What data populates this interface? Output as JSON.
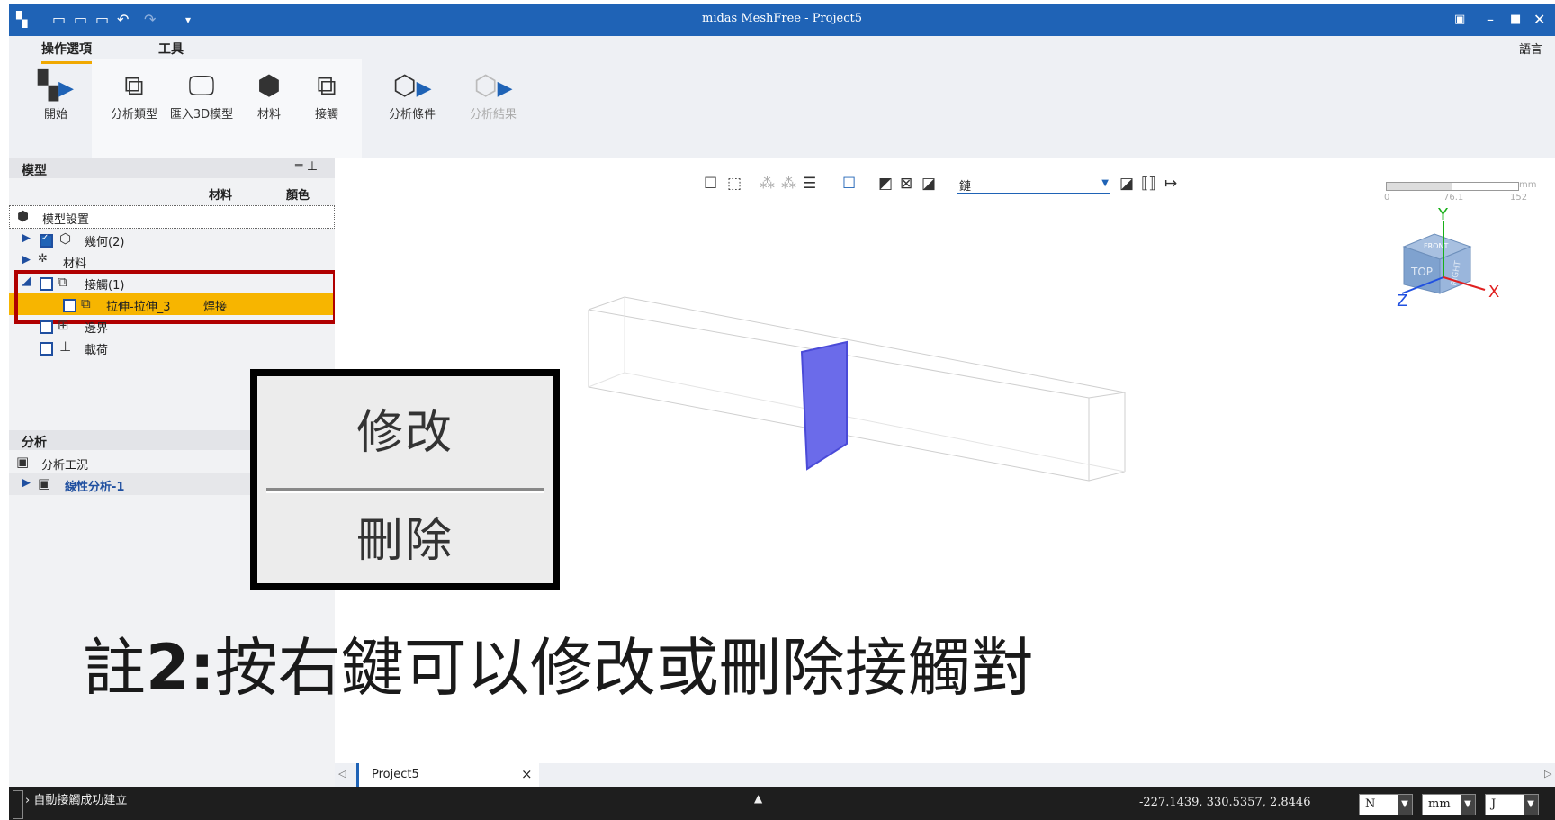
{
  "window": {
    "title": "midas MeshFree - Project5",
    "controls": [
      "restore-icon",
      "minimize-icon",
      "maximize-icon",
      "close-icon"
    ]
  },
  "ribbon": {
    "tabs": [
      {
        "label": "操作選項",
        "active": true
      },
      {
        "label": "工具",
        "active": false
      }
    ],
    "language_label": "語言",
    "buttons": [
      {
        "label": "開始",
        "icon": "grid-start-icon"
      },
      {
        "label": "分析類型",
        "icon": "analysis-type-icon"
      },
      {
        "label": "匯入3D模型",
        "icon": "import-3d-icon"
      },
      {
        "label": "材料",
        "icon": "material-icon"
      },
      {
        "label": "接觸",
        "icon": "contact-icon"
      },
      {
        "label": "分析條件",
        "icon": "analysis-condition-icon"
      },
      {
        "label": "分析結果",
        "icon": "analysis-result-icon",
        "disabled": true
      }
    ]
  },
  "model_panel": {
    "title": "模型",
    "col_material": "材料",
    "col_color": "顏色",
    "settings_label": "模型設置",
    "geometry_label": "幾何(2)",
    "material_label": "材料",
    "contact_label": "接觸(1)",
    "contact_item_label": "拉伸-拉伸_3",
    "contact_item_type": "焊接",
    "boundary_label": "邊界",
    "load_label": "載荷"
  },
  "analysis_panel": {
    "title": "分析",
    "case_label": "分析工況",
    "linear_label": "線性分析-1"
  },
  "context_menu": {
    "modify_label": "修改",
    "delete_label": "刪除"
  },
  "note": {
    "prefix": "註",
    "number": "2:",
    "text": "按右鍵可以修改或刪除接觸對"
  },
  "viewport": {
    "display_dropdown_value": "鏈",
    "scale_labels": [
      "0",
      "76.1",
      "152"
    ],
    "scale_unit": "mm",
    "axes": {
      "x": "X",
      "y": "Y",
      "z": "Z"
    },
    "cube_faces": {
      "top": "TOP",
      "right": "RIGHT",
      "front": "FRONT"
    },
    "accent_face_color": "#6b6bea",
    "cube_color": "#7fa2cf"
  },
  "doc_tab": {
    "label": "Project5",
    "close": "×"
  },
  "status": {
    "message": "自動接觸成功建立",
    "coords": "-227.1439, 330.5357, 2.8446",
    "force_unit": "N",
    "length_unit": "mm",
    "energy_unit": "J"
  },
  "colors": {
    "titlebar": "#1f63b6",
    "highlight_row": "#f7b500",
    "callout_border": "#b00000",
    "statusbar": "#1e1e1e"
  }
}
